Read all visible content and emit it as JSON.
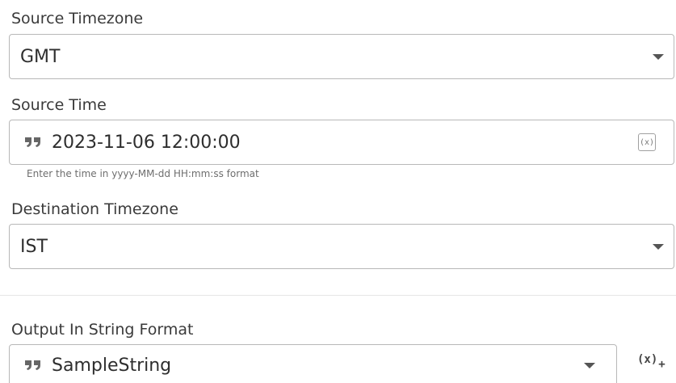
{
  "source_timezone": {
    "label": "Source Timezone",
    "value": "GMT",
    "icon": "chevron-down-icon"
  },
  "source_time": {
    "label": "Source Time",
    "value": "2023-11-06 12:00:00",
    "helper": "Enter the time in yyyy-MM-dd HH:mm:ss format",
    "quote_icon": "quote-icon",
    "variable_button": "(x)"
  },
  "destination_timezone": {
    "label": "Destination Timezone",
    "value": "IST",
    "icon": "chevron-down-icon"
  },
  "output": {
    "label": "Output In String Format",
    "value": "SampleString",
    "quote_icon": "quote-icon",
    "add_variable_label": "(x)",
    "add_variable_plus": "+"
  },
  "colors": {
    "border": "#b8b8b8",
    "text": "#2e2e2e",
    "label": "#3a3a3a",
    "helper": "#6e6e6e",
    "icon": "#555555"
  }
}
